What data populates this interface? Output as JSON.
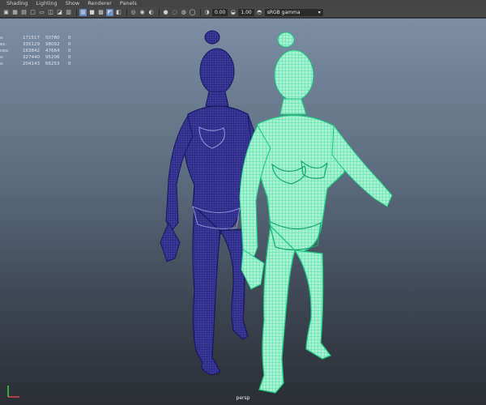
{
  "menu": {
    "items": [
      "Shading",
      "Lighting",
      "Show",
      "Renderer",
      "Panels"
    ]
  },
  "toolbar": {
    "exposure_value": "0.00",
    "gamma_value": "1.00",
    "colorspace": "sRGB gamma",
    "icons": [
      "camera-icon",
      "grid-icon",
      "film-icon",
      "resolution-icon",
      "gate-icon",
      "field-chart-icon",
      "safe-action-icon",
      "wireframe-icon",
      "smooth-shade-icon",
      "textured-icon",
      "lights-icon",
      "shadows-icon",
      "xray-icon",
      "xray-joints-icon",
      "isolate-icon",
      "ao-icon",
      "motion-blur-icon",
      "aa-icon",
      "dof-icon"
    ]
  },
  "hud": {
    "rows": [
      {
        "label": "s:",
        "v1": "171517",
        "v2": "50780",
        "v3": "0"
      },
      {
        "label": "es:",
        "v1": "335129",
        "v2": "98092",
        "v3": "0"
      },
      {
        "label": "ces:",
        "v1": "163842",
        "v2": "47664",
        "v3": "0"
      },
      {
        "label": "s:",
        "v1": "327440",
        "v2": "95206",
        "v3": "0"
      },
      {
        "label": "s:",
        "v1": "204143",
        "v2": "66253",
        "v3": "0"
      }
    ]
  },
  "viewport": {
    "camera": "persp"
  },
  "colors": {
    "wire_dark": "#2a2680",
    "wire_green": "#35e0a0",
    "selected_fill": "#a8f0cf"
  }
}
